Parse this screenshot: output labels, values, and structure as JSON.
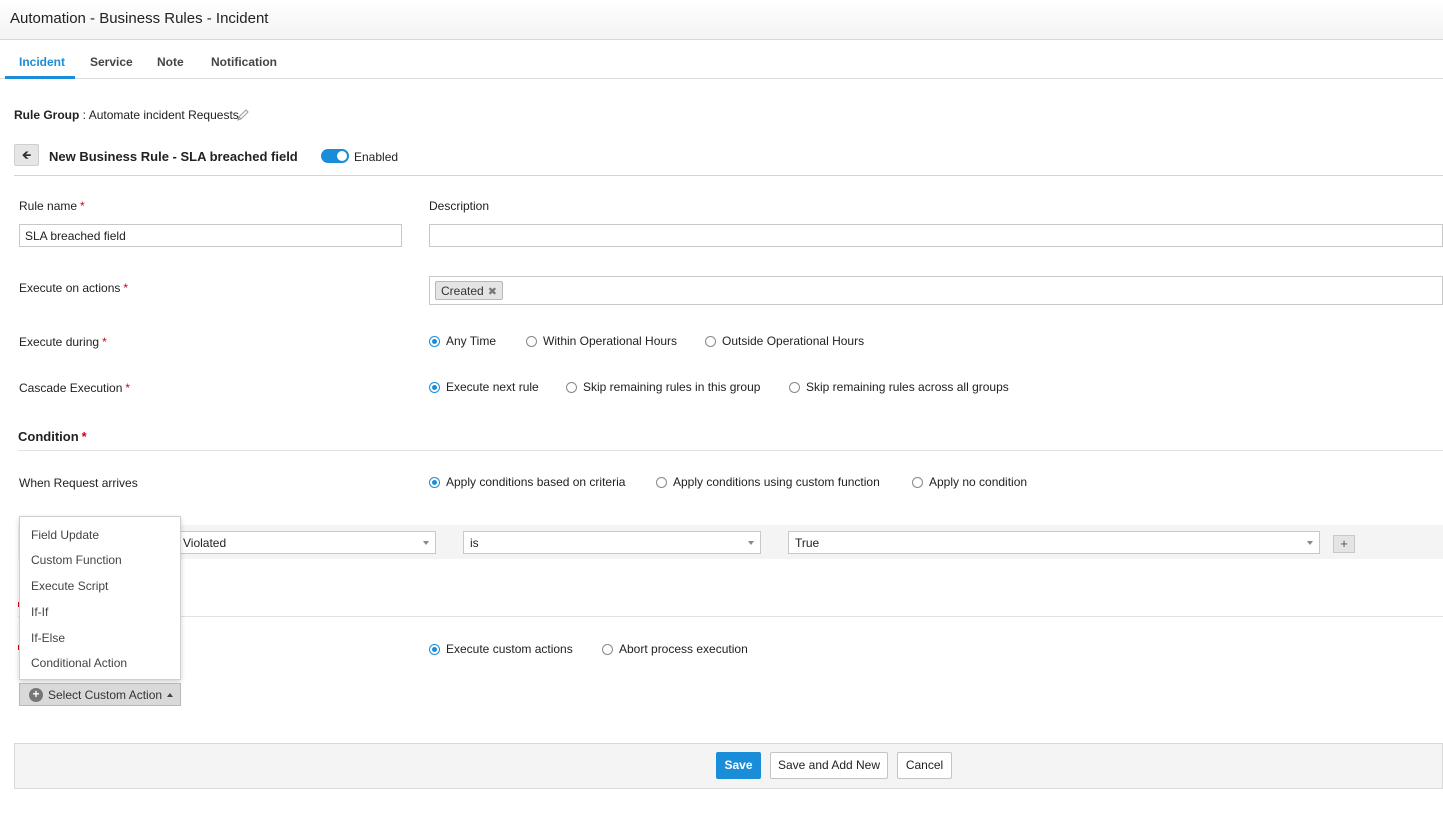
{
  "window": {
    "title": "Automation - Business Rules - Incident"
  },
  "tabs": [
    {
      "label": "Incident",
      "active": true
    },
    {
      "label": "Service"
    },
    {
      "label": "Note"
    },
    {
      "label": "Notification"
    }
  ],
  "rule_group": {
    "label": "Rule Group",
    "separator": " : ",
    "value": "Automate incident Requests",
    "edit_icon": "pencil-icon"
  },
  "rule_header": {
    "back_icon": "arrow-left-icon",
    "title": "New Business Rule - SLA breached field",
    "toggle_label": "Enabled",
    "toggle_on": true
  },
  "form": {
    "rule_name_label": "Rule name",
    "rule_name_value": "SLA breached field",
    "description_label": "Description",
    "description_value": "",
    "execute_on_actions_label": "Execute on actions",
    "execute_on_actions_tags": [
      "Created"
    ],
    "execute_during_label": "Execute during",
    "execute_during_options": [
      "Any Time",
      "Within Operational Hours",
      "Outside Operational Hours"
    ],
    "cascade_label": "Cascade Execution",
    "cascade_options": [
      "Execute next rule",
      "Skip remaining rules in this group",
      "Skip remaining rules across all groups"
    ],
    "required_mark": "*"
  },
  "condition": {
    "title": "Condition",
    "when_label": "When Request arrives",
    "when_options": [
      "Apply conditions based on criteria",
      "Apply conditions using custom function",
      "Apply no condition"
    ],
    "criteria": {
      "field": "Violated",
      "operator": "is",
      "value": "True",
      "add_label": "+"
    }
  },
  "actions": {
    "options": [
      "Execute custom actions",
      "Abort process execution"
    ],
    "select_button_label": "Select Custom Action",
    "menu_items": [
      "Field Update",
      "Custom Function",
      "Execute Script",
      "If-If",
      "If-Else",
      "Conditional Action"
    ]
  },
  "footer": {
    "save": "Save",
    "save_add_new": "Save and Add New",
    "cancel": "Cancel"
  },
  "colors": {
    "accent": "#1a8dd8",
    "required": "#d0021b"
  }
}
